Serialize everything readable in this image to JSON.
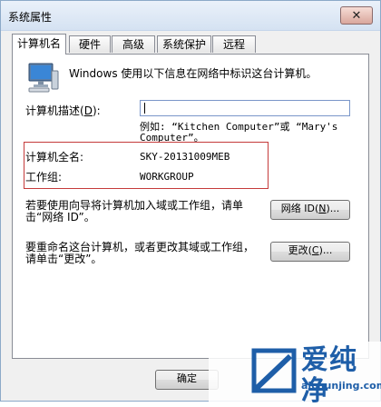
{
  "window": {
    "title": "系统属性",
    "close_glyph": "✕"
  },
  "tabs": [
    {
      "label": "计算机名",
      "active": true
    },
    {
      "label": "硬件",
      "active": false
    },
    {
      "label": "高级",
      "active": false
    },
    {
      "label": "系统保护",
      "active": false
    },
    {
      "label": "远程",
      "active": false
    }
  ],
  "panel": {
    "intro_text": "Windows 使用以下信息在网络中标识这台计算机。",
    "description_label_main": "计算机描述(",
    "description_label_key": "D",
    "description_label_end": "):",
    "description_value": "",
    "example_line1": "例如: “Kitchen Computer”或 “Mary's",
    "example_line2": "Computer”。",
    "fullname_label": "计算机全名:",
    "fullname_value": "SKY-20131009MEB",
    "workgroup_label": "工作组:",
    "workgroup_value": "WORKGROUP",
    "network_id_text_line1": "若要使用向导将计算机加入域或工作组，请单",
    "network_id_text_line2": "击“网络 ID”。",
    "network_id_button_main": "网络 ID(",
    "network_id_button_key": "N",
    "network_id_button_end": ")...",
    "rename_text_line1": "要重命名这台计算机，或者更改其域或工作组，",
    "rename_text_line2": "请单击“更改”。",
    "change_button_main": "更改(",
    "change_button_key": "C",
    "change_button_end": ")..."
  },
  "footer": {
    "ok_label": "确定"
  },
  "watermark": {
    "brand": "爱纯净",
    "url": "aichunjing.com"
  },
  "colors": {
    "highlight_border": "#c53b3b",
    "watermark_blue": "#1e5ea8"
  }
}
